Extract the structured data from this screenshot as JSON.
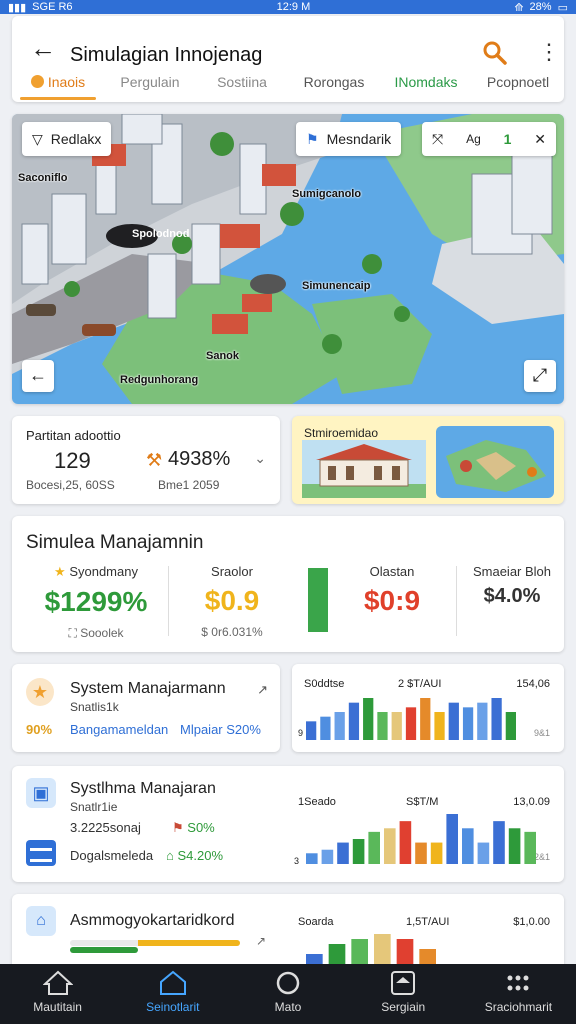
{
  "status_bar": {
    "left": "SGE R6",
    "time": "12:9 M",
    "right": "28%"
  },
  "appbar": {
    "title": "Simulagian Innojenag",
    "tabs": [
      {
        "label": "Inaois",
        "state": "active"
      },
      {
        "label": "Pergulain",
        "state": "muted"
      },
      {
        "label": "Sostiina",
        "state": "muted"
      },
      {
        "label": "Rorongas",
        "state": "normal"
      },
      {
        "label": "INomdaks",
        "state": "green"
      },
      {
        "label": "Pcopnoetl",
        "state": "normal"
      }
    ]
  },
  "map": {
    "chip_left": "Redlakx",
    "chip_mid": "Mesndarik",
    "chip_right_text": "Ag",
    "chip_right_count": "1",
    "labels": [
      "Saconiflo",
      "Spolodnod",
      "Sumigcanolo",
      "Simunencaip",
      "Sanok",
      "Redgunhorang"
    ]
  },
  "perf_card": {
    "label": "Partitan adoottio",
    "value1": "129",
    "value2": "4938%",
    "sub1": "Bocesi,25, 60SS",
    "sub2": "Bme1 2059"
  },
  "promo_card": {
    "label": "Stmiroemidao"
  },
  "sim_card": {
    "title": "Simulea Manajamnin",
    "metrics": [
      {
        "label": "Syondmany",
        "value": "$1299%",
        "sub": "Sooolek",
        "color": "#2e9a3a"
      },
      {
        "label": "Sraolor",
        "value": "$0.9",
        "sub": "$ 0r6.031%",
        "color": "#f0b41c"
      },
      {
        "label": "Olastan",
        "value": "$0:9",
        "sub": "",
        "color": "#e0402a"
      },
      {
        "label": "Smaeiar Bloh",
        "value": "$4.0%",
        "sub": "",
        "color": "#333333"
      }
    ],
    "gauge_level": 1.0
  },
  "sys_cards": [
    {
      "title": "System Manajarmann",
      "sub": "Snatlis1k",
      "stat_left": "90%",
      "stat_mid": "Bangamameldan",
      "stat_right": "Mlpaiar S20%",
      "bar_label_left": "S0ddtse",
      "bar_label_mid": "2 $T/AUI",
      "bar_label_right": "154,06",
      "bar_foot_left": "9",
      "bar_foot_right": "9&1"
    },
    {
      "title": "Systlhma Manajaran",
      "sub": "Snatlr1ie",
      "stat_left": "3.2225sonaj",
      "stat_mid": "S0%",
      "stat_right": "S4.20%",
      "stat_bottom": "Dogalsmeleda",
      "bar_label_left": "1Seado",
      "bar_label_mid": "S$T/M",
      "bar_label_right": "13,0.09",
      "bar_foot_left": "3",
      "bar_foot_right": "2&1"
    },
    {
      "title": "Asmmogyokartaridkord",
      "bar_label_left": "Soarda",
      "bar_label_mid": "1,5T/AUI",
      "bar_label_right": "$1,0.00"
    }
  ],
  "chart_data": [
    {
      "type": "bar",
      "values": [
        2,
        2.5,
        3,
        4,
        4.5,
        3,
        3,
        3.5,
        4.5,
        3,
        4,
        3.5,
        4,
        4.5,
        3
      ]
    },
    {
      "type": "bar",
      "values": [
        1.5,
        2,
        3,
        3.5,
        4.5,
        5,
        6,
        3,
        3,
        7,
        5,
        3,
        6,
        5,
        4.5
      ]
    },
    {
      "type": "bar",
      "values": [
        2,
        4,
        5,
        6,
        5,
        3
      ]
    }
  ],
  "bottom_nav": [
    {
      "label": "Mautitain",
      "icon": "house-icon",
      "active": false
    },
    {
      "label": "Seinotlarit",
      "icon": "home-outline-icon",
      "active": true
    },
    {
      "label": "Mato",
      "icon": "circle-icon",
      "active": false
    },
    {
      "label": "Sergiain",
      "icon": "home-box-icon",
      "active": false
    },
    {
      "label": "Sraciohmarit",
      "icon": "dots-grid-icon",
      "active": false
    }
  ],
  "colors": {
    "accent": "#f0a030",
    "primary": "#2f6fd6",
    "green": "#2e9a3a",
    "red": "#e0402a"
  }
}
